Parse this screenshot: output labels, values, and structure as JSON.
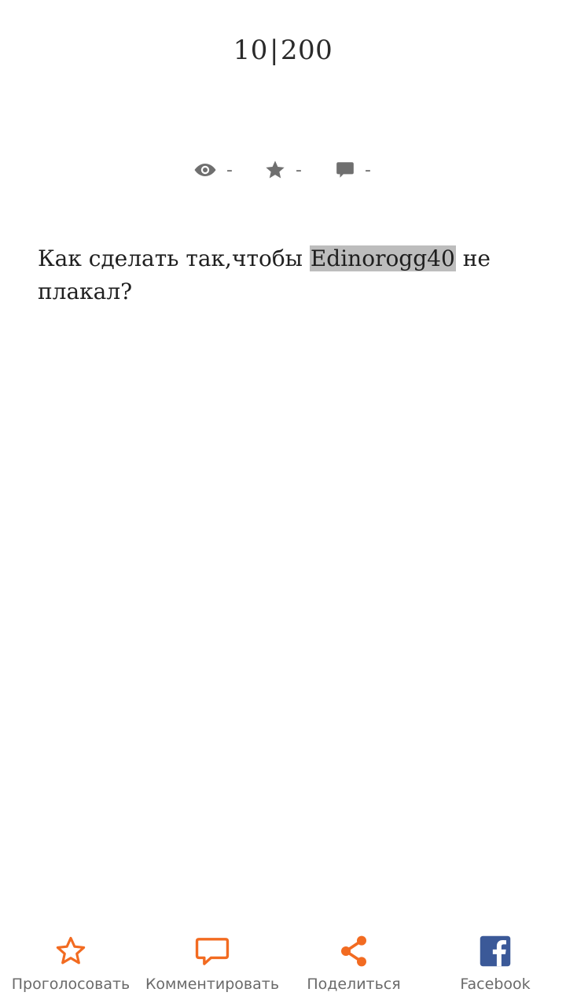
{
  "header": {
    "current_page": "10",
    "separator": "|",
    "total_pages": "200"
  },
  "stats": {
    "views": "-",
    "rating": "-",
    "comments": "-"
  },
  "story": {
    "text_before": "Как сделать так,чтобы ",
    "mention": "Edinorogg40",
    "text_after": " не плакал?"
  },
  "actions": {
    "vote": {
      "label": "Проголосовать",
      "icon": "star-outline-icon"
    },
    "comment": {
      "label": "Комментировать",
      "icon": "comment-icon"
    },
    "share": {
      "label": "Поделиться",
      "icon": "share-icon"
    },
    "facebook": {
      "label": "Facebook",
      "icon": "facebook-icon"
    }
  },
  "colors": {
    "accent": "#f26b21",
    "facebook": "#3b5998",
    "muted": "#6f6f6f",
    "highlight": "#bdbdbd"
  }
}
